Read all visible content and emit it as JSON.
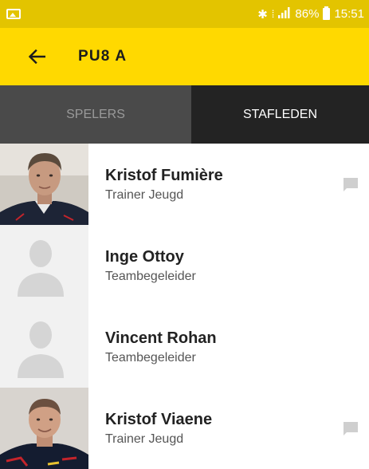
{
  "status_bar": {
    "battery_level": "86%",
    "time": "15:51",
    "icons": [
      "gallery-icon",
      "bluetooth-icon",
      "vibrate-icon",
      "signal-icon",
      "battery-icon"
    ]
  },
  "app_bar": {
    "title": "PU8 A",
    "back_icon": "arrow-left-icon"
  },
  "tabs": [
    {
      "label": "SPELERS",
      "selected": false
    },
    {
      "label": "STAFLEDEN",
      "selected": true
    }
  ],
  "staff": [
    {
      "name": "Kristof Fumière",
      "role": "Trainer Jeugd",
      "avatar": "photo",
      "has_message": true
    },
    {
      "name": "Inge Ottoy",
      "role": "Teambegeleider",
      "avatar": "placeholder",
      "has_message": false
    },
    {
      "name": "Vincent Rohan",
      "role": "Teambegeleider",
      "avatar": "placeholder",
      "has_message": false
    },
    {
      "name": "Kristof Viaene",
      "role": "Trainer Jeugd",
      "avatar": "photo",
      "has_message": true
    }
  ],
  "colors": {
    "status_bar": "#e3c400",
    "app_bar": "#ffd900",
    "tab_inactive": "#4a4a4a",
    "tab_active": "#232323",
    "message_icon": "#cfcfcf"
  }
}
